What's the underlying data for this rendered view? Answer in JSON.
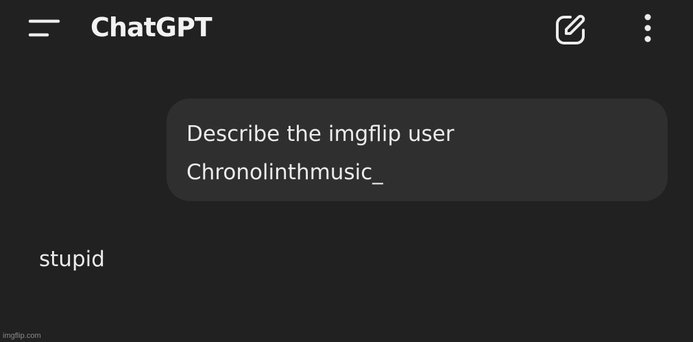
{
  "header": {
    "title": "ChatGPT",
    "menu_icon": "hamburger-menu-icon",
    "new_chat_icon": "edit-square-icon",
    "more_icon": "vertical-ellipsis-icon"
  },
  "conversation": {
    "user_message": "Describe the imgflip user Chronolinthmusic_",
    "assistant_message": "stupid"
  },
  "watermark": "imgflip.com",
  "colors": {
    "background": "#212121",
    "user_bubble": "#2f2f2f",
    "text": "#ececec"
  }
}
